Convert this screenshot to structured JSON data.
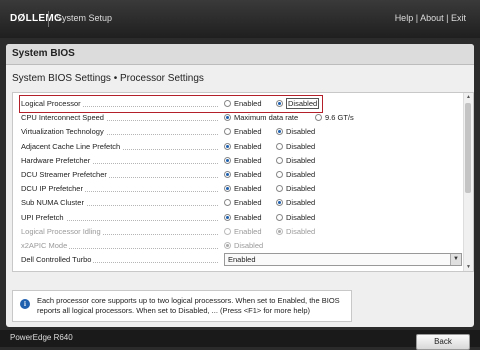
{
  "topbar": {
    "logo": "DØLLEMC",
    "title": "System Setup",
    "help": "Help",
    "about": "About",
    "exit": "Exit",
    "sep": "|"
  },
  "panel": {
    "header": "System BIOS",
    "subtitle": "System BIOS Settings • Processor Settings"
  },
  "settings": [
    {
      "label": "Logical Processor",
      "options": [
        "Enabled",
        "Disabled"
      ],
      "selected": 1,
      "disabled": false,
      "highlighted": true
    },
    {
      "label": "CPU Interconnect Speed",
      "options": [
        "Maximum data rate",
        "9.6 GT/s"
      ],
      "selected": 0,
      "disabled": false
    },
    {
      "label": "Virtualization Technology",
      "options": [
        "Enabled",
        "Disabled"
      ],
      "selected": 1,
      "disabled": false
    },
    {
      "label": "Adjacent Cache Line Prefetch",
      "options": [
        "Enabled",
        "Disabled"
      ],
      "selected": 0,
      "disabled": false
    },
    {
      "label": "Hardware Prefetcher",
      "options": [
        "Enabled",
        "Disabled"
      ],
      "selected": 0,
      "disabled": false
    },
    {
      "label": "DCU Streamer Prefetcher",
      "options": [
        "Enabled",
        "Disabled"
      ],
      "selected": 0,
      "disabled": false
    },
    {
      "label": "DCU IP Prefetcher",
      "options": [
        "Enabled",
        "Disabled"
      ],
      "selected": 0,
      "disabled": false
    },
    {
      "label": "Sub NUMA Cluster",
      "options": [
        "Enabled",
        "Disabled"
      ],
      "selected": 1,
      "disabled": false
    },
    {
      "label": "UPI Prefetch",
      "options": [
        "Enabled",
        "Disabled"
      ],
      "selected": 0,
      "disabled": false
    },
    {
      "label": "Logical Processor Idling",
      "options": [
        "Enabled",
        "Disabled"
      ],
      "selected": 1,
      "disabled": true
    },
    {
      "label": "x2APIC Mode",
      "options": [
        "Disabled"
      ],
      "selected": 0,
      "disabled": true
    },
    {
      "label": "Dell Controlled Turbo",
      "dropdown": "Enabled",
      "disabled": false
    }
  ],
  "help_text": "Each processor core supports up to two logical processors. When set to Enabled, the BIOS reports all logical processors. When set to Disabled, ... (Press <F1> for more help)",
  "footer": {
    "model": "PowerEdge R640",
    "back": "Back"
  }
}
